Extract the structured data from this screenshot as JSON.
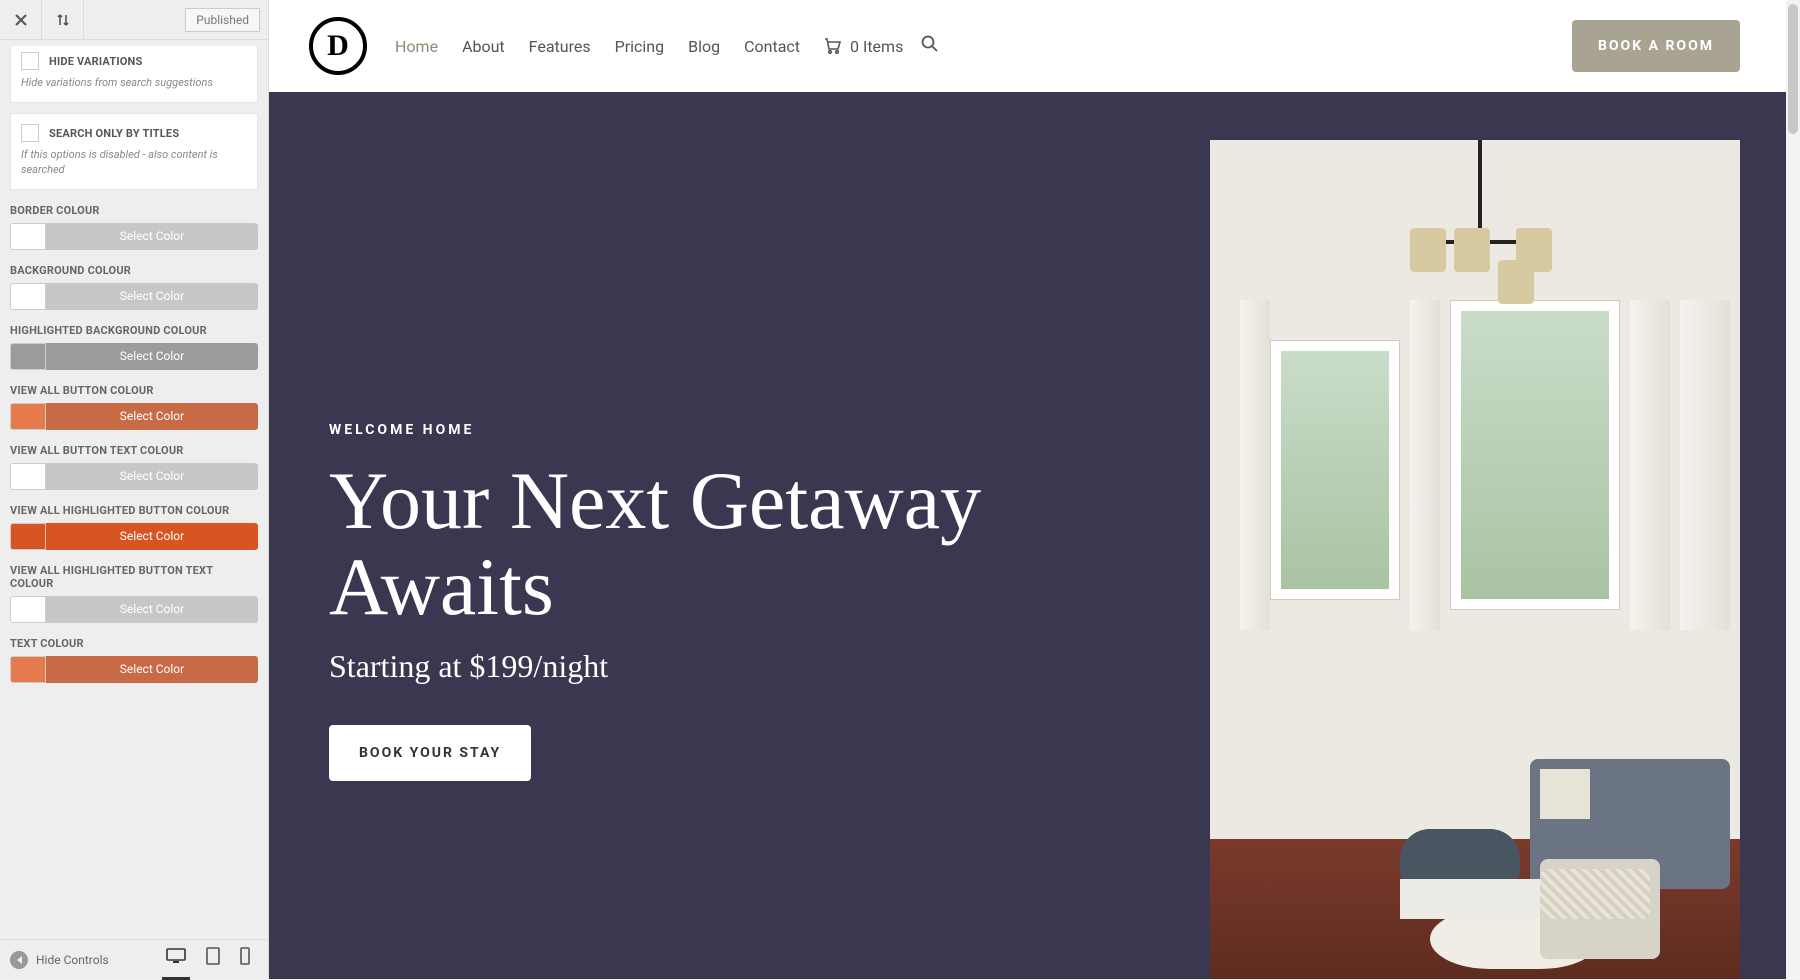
{
  "sidebar": {
    "header": {
      "published": "Published"
    },
    "options": {
      "hideVariations": {
        "label": "HIDE VARIATIONS",
        "desc": "Hide variations from search suggestions"
      },
      "searchTitles": {
        "label": "SEARCH ONLY BY TITLES",
        "desc": "If this options is disabled - also content is searched"
      }
    },
    "colors": [
      {
        "label": "BORDER COLOUR",
        "btn": "Select Color",
        "swatch": "#ffffff",
        "bar": "#c7c7c7"
      },
      {
        "label": "BACKGROUND COLOUR",
        "btn": "Select Color",
        "swatch": "#ffffff",
        "bar": "#c7c7c7"
      },
      {
        "label": "HIGHLIGHTED BACKGROUND COLOUR",
        "btn": "Select Color",
        "swatch": "#9b9b9b",
        "bar": "#9b9b9b"
      },
      {
        "label": "VIEW ALL BUTTON COLOUR",
        "btn": "Select Color",
        "swatch": "#e77a4d",
        "bar": "#c86a46"
      },
      {
        "label": "VIEW ALL BUTTON TEXT COLOUR",
        "btn": "Select Color",
        "swatch": "#ffffff",
        "bar": "#c7c7c7"
      },
      {
        "label": "VIEW ALL HIGHLIGHTED BUTTON COLOUR",
        "btn": "Select Color",
        "swatch": "#d85420",
        "bar": "#d85420"
      },
      {
        "label": "VIEW ALL HIGHLIGHTED BUTTON TEXT COLOUR",
        "btn": "Select Color",
        "swatch": "#ffffff",
        "bar": "#c7c7c7"
      },
      {
        "label": "TEXT COLOUR",
        "btn": "Select Color",
        "swatch": "#e77a4d",
        "bar": "#c86a46"
      }
    ],
    "footer": {
      "hide": "Hide Controls"
    }
  },
  "nav": {
    "logo": "D",
    "items": [
      "Home",
      "About",
      "Features",
      "Pricing",
      "Blog",
      "Contact"
    ],
    "cart": "0 Items",
    "cta": "BOOK A ROOM"
  },
  "hero": {
    "eyebrow": "WELCOME HOME",
    "headline": "Your Next Getaway Awaits",
    "sub": "Starting at $199/night",
    "cta": "BOOK YOUR STAY"
  }
}
